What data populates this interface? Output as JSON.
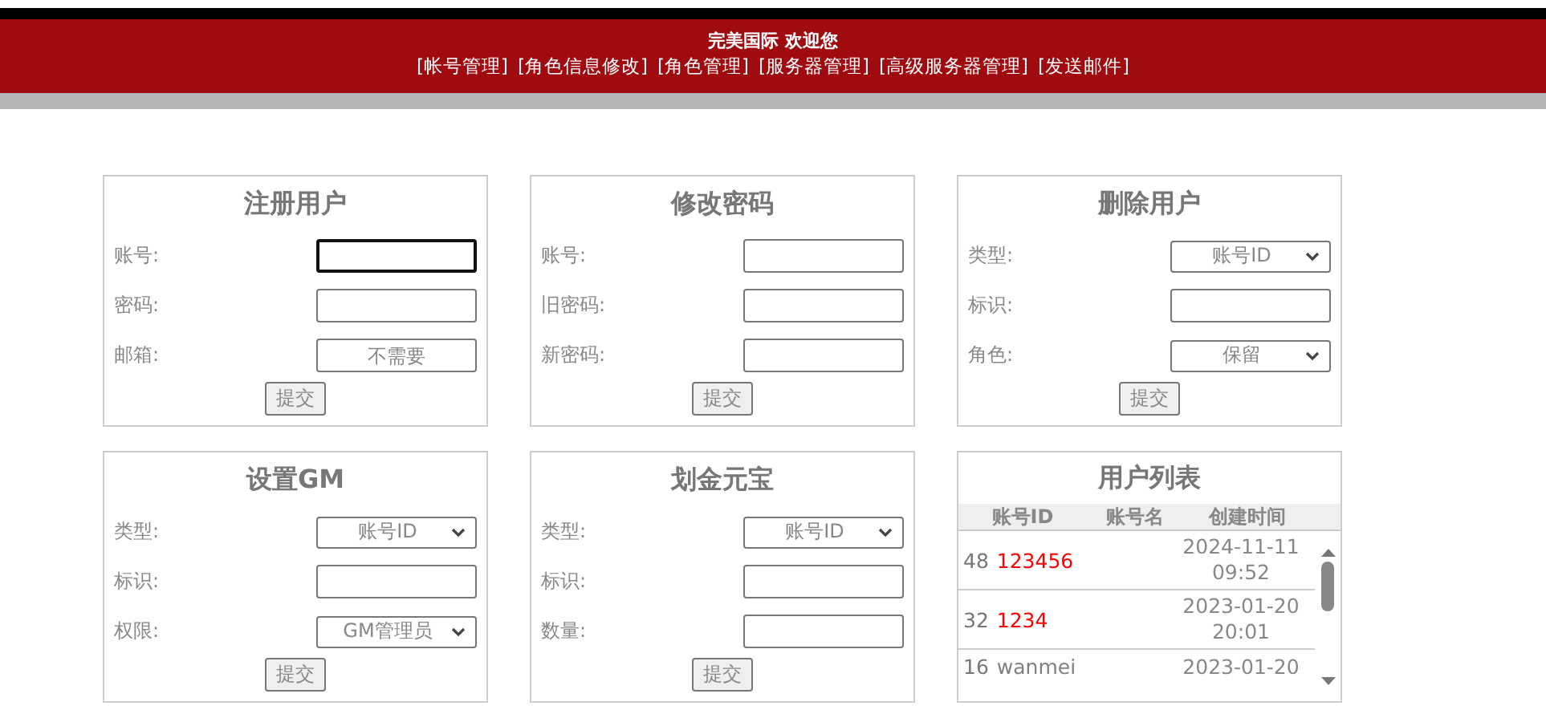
{
  "header": {
    "title": "完美国际 欢迎您",
    "nav": [
      "[帐号管理]",
      "[角色信息修改]",
      "[角色管理]",
      "[服务器管理]",
      "[高级服务器管理]",
      "[发送邮件]"
    ]
  },
  "panels": [
    {
      "title": "注册用户",
      "fields": [
        {
          "label": "账号:",
          "kind": "input",
          "focused": true
        },
        {
          "label": "密码:",
          "kind": "input",
          "focused": false
        },
        {
          "label": "邮箱:",
          "kind": "input",
          "focused": false,
          "placeholder": "不需要"
        }
      ],
      "button": "提交"
    },
    {
      "title": "修改密码",
      "fields": [
        {
          "label": "账号:",
          "kind": "input",
          "focused": false
        },
        {
          "label": "旧密码:",
          "kind": "input",
          "focused": false
        },
        {
          "label": "新密码:",
          "kind": "input",
          "focused": false
        }
      ],
      "button": "提交"
    },
    {
      "title": "删除用户",
      "fields": [
        {
          "label": "类型:",
          "kind": "select",
          "value": "账号ID"
        },
        {
          "label": "标识:",
          "kind": "input",
          "focused": false
        },
        {
          "label": "角色:",
          "kind": "select",
          "value": "保留"
        }
      ],
      "button": "提交"
    },
    {
      "title": "设置GM",
      "fields": [
        {
          "label": "类型:",
          "kind": "select",
          "value": "账号ID"
        },
        {
          "label": "标识:",
          "kind": "input",
          "focused": false
        },
        {
          "label": "权限:",
          "kind": "select",
          "value": "GM管理员"
        }
      ],
      "button": "提交"
    },
    {
      "title": "划金元宝",
      "fields": [
        {
          "label": "类型:",
          "kind": "select",
          "value": "账号ID"
        },
        {
          "label": "标识:",
          "kind": "input",
          "focused": false
        },
        {
          "label": "数量:",
          "kind": "input",
          "focused": false
        }
      ],
      "button": "提交"
    }
  ],
  "user_list": {
    "title": "用户列表",
    "columns": [
      "账号ID",
      "账号名",
      "创建时间"
    ],
    "rows": [
      {
        "id": "48",
        "name": "123456",
        "color": "#ff0000",
        "created": [
          "2024-11-11",
          "09:52"
        ]
      },
      {
        "id": "32",
        "name": "1234",
        "color": "#ff0000",
        "created": [
          "2023-01-20",
          "20:01"
        ]
      },
      {
        "id": "16",
        "name": "wanmei",
        "color": "#808080",
        "created": [
          "2023-01-20"
        ]
      }
    ]
  }
}
